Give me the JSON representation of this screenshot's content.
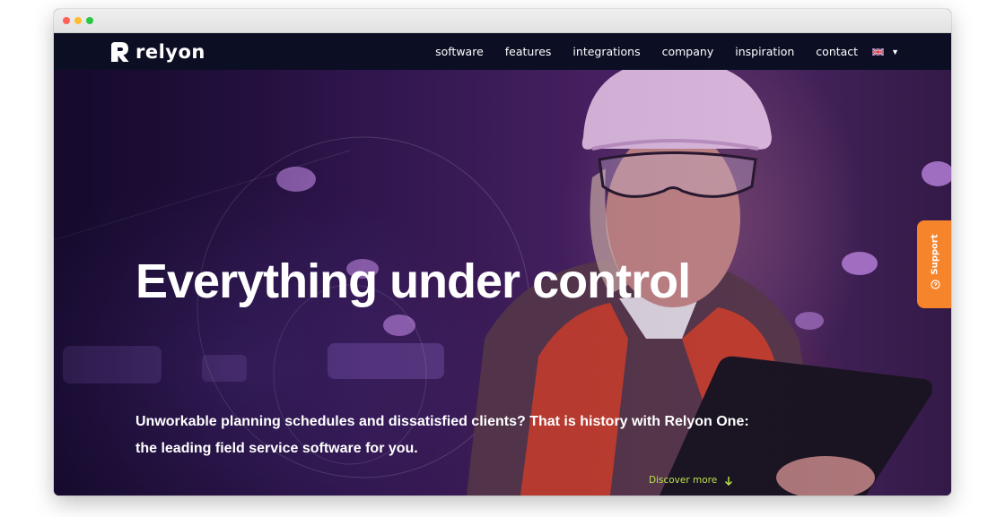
{
  "brand": {
    "name": "relyon"
  },
  "nav": {
    "items": [
      "software",
      "features",
      "integrations",
      "company",
      "inspiration",
      "contact"
    ],
    "language_flag_icon": "uk-flag-icon",
    "language_caret_icon": "caret-down-icon"
  },
  "hero": {
    "title": "Everything under control",
    "subtitle": "Unworkable planning schedules and dissatisfied clients? That is history with Relyon One: the leading field service software for you.",
    "discover_label": "Discover more",
    "discover_icon": "arrow-down-icon"
  },
  "support": {
    "label": "Support",
    "icon": "chat-icon"
  },
  "colors": {
    "nav_bg": "#0c0f24",
    "accent_green": "#b8e24a",
    "support_orange": "#f5842b",
    "hero_purple": "#5a2a78"
  }
}
